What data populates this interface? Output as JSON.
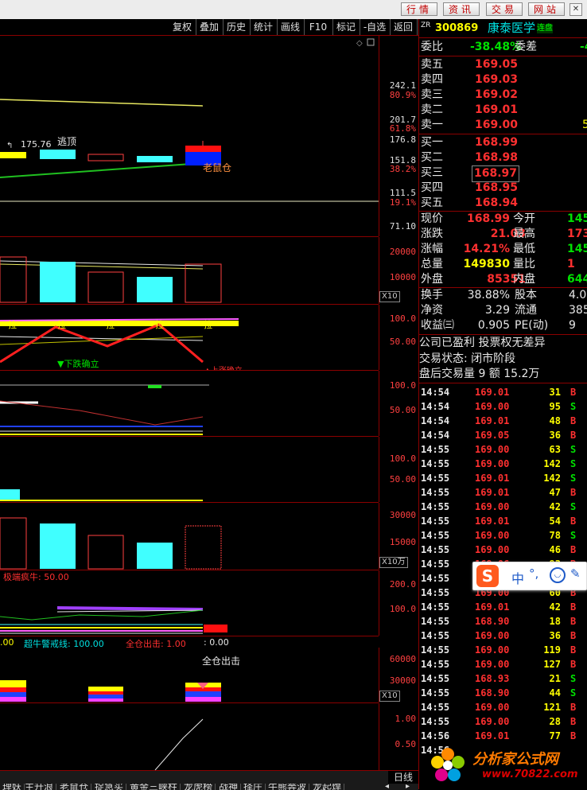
{
  "menubar": {
    "buttons": [
      "行情",
      "资讯",
      "交易",
      "网站"
    ]
  },
  "toolbar": {
    "buttons": [
      "复权",
      "叠加",
      "历史",
      "统计",
      "画线",
      "F10",
      "标记",
      "-自选",
      "返回"
    ]
  },
  "main_pane": {
    "ticks": [
      {
        "v": "242.1",
        "c": "w"
      },
      {
        "v": "80.9%",
        "c": "r"
      },
      {
        "v": "201.7",
        "c": "w"
      },
      {
        "v": "61.8%",
        "c": "r"
      },
      {
        "v": "176.8",
        "c": "w"
      },
      {
        "v": "151.8",
        "c": "w"
      },
      {
        "v": "38.2%",
        "c": "r"
      },
      {
        "v": "111.5",
        "c": "w"
      },
      {
        "v": "19.1%",
        "c": "r"
      },
      {
        "v": "71.10",
        "c": "w"
      }
    ],
    "high_label": "175.76",
    "escape_label": "逃顶",
    "rat_label": "老鼠仓"
  },
  "vol_pane1": {
    "ticks": [
      "20000",
      "10000"
    ],
    "unit": "X10"
  },
  "ind_pane1": {
    "ticks": [
      "100.0",
      "50.00"
    ],
    "down_label": "▼下跌确立",
    "up_label": "▲上涨确立",
    "marks": [
      "拉",
      "拉",
      "拉",
      "拉",
      "拉"
    ]
  },
  "ind_pane2": {
    "ticks": [
      "100.0",
      "50.00"
    ]
  },
  "ind_pane3": {
    "ticks": [
      "100.0",
      "50.00"
    ]
  },
  "vol_pane2": {
    "ticks": [
      "30000",
      "15000"
    ],
    "unit": "X10万"
  },
  "ind_pane4": {
    "ticks": [
      "200.0",
      "100.0"
    ],
    "title": "极端疯牛: 50.00",
    "footer_a": ".00",
    "footer_b": "超牛警戒线: 100.00",
    "footer_c": "全仓出击: 1.00",
    "footer_d": ": 0.00"
  },
  "vol_pane3": {
    "ticks": [
      "60000",
      "30000"
    ],
    "unit": "X10",
    "label": "全仓出击"
  },
  "ind_pane5": {
    "ticks": [
      "1.00",
      "0.50"
    ]
  },
  "tabs": [
    "理妖",
    "主升浪",
    "老鼠仓",
    "捉急买",
    "黄金三峡柱",
    "龙虎榜",
    "战神",
    "择庄",
    "牛熊奔波",
    "龙起焊"
  ],
  "tabs_right": "日线",
  "quote": {
    "code_prefix": "ZR",
    "code": "300869",
    "name": "康泰医学",
    "badge": "连盘",
    "weibi_label": "委比",
    "weibi_value": "-38.48%",
    "weicha_label": "委差",
    "weicha_value": "-4",
    "asks": [
      {
        "label": "卖五",
        "price": "169.05",
        "vol": ""
      },
      {
        "label": "卖四",
        "price": "169.03",
        "vol": ""
      },
      {
        "label": "卖三",
        "price": "169.02",
        "vol": ""
      },
      {
        "label": "卖二",
        "price": "169.01",
        "vol": ""
      },
      {
        "label": "卖一",
        "price": "169.00",
        "vol": "5"
      }
    ],
    "bids": [
      {
        "label": "买一",
        "price": "168.99",
        "vol": ""
      },
      {
        "label": "买二",
        "price": "168.98",
        "vol": ""
      },
      {
        "label": "买三",
        "price": "168.97",
        "vol": ""
      },
      {
        "label": "买四",
        "price": "168.95",
        "vol": ""
      },
      {
        "label": "买五",
        "price": "168.94",
        "vol": ""
      }
    ],
    "stats": [
      {
        "l1": "现价",
        "v1": "168.99",
        "c1": "red",
        "l2": "今开",
        "v2": "145",
        "c2": "green"
      },
      {
        "l1": "涨跌",
        "v1": "21.03",
        "c1": "red",
        "l2": "最高",
        "v2": "173",
        "c2": "red"
      },
      {
        "l1": "涨幅",
        "v1": "14.21%",
        "c1": "red",
        "l2": "最低",
        "v2": "145",
        "c2": "green"
      },
      {
        "l1": "总量",
        "v1": "149830",
        "c1": "yellow",
        "l2": "量比",
        "v2": "1",
        "c2": "red"
      },
      {
        "l1": "外盘",
        "v1": "85351",
        "c1": "red",
        "l2": "内盘",
        "v2": "644",
        "c2": "green"
      }
    ],
    "stats2": [
      {
        "l1": "换手",
        "v1": "38.88%",
        "c1": "white",
        "l2": "股本",
        "v2": "4.0"
      },
      {
        "l1": "净资",
        "v1": "3.29",
        "c1": "white",
        "l2": "流通",
        "v2": "385"
      },
      {
        "l1": "收益㈢",
        "v1": "0.905",
        "c1": "white",
        "l2": "PE(动)",
        "v2": "9"
      }
    ],
    "info": [
      "公司已盈利 投票权无差异",
      "交易状态: 闭市阶段",
      "盘后交易量 9 额 15.2万"
    ]
  },
  "trades": [
    {
      "t": "14:54",
      "p": "169.01",
      "v": "31",
      "s": "B"
    },
    {
      "t": "14:54",
      "p": "169.00",
      "v": "95",
      "s": "S"
    },
    {
      "t": "14:54",
      "p": "169.01",
      "v": "48",
      "s": "B"
    },
    {
      "t": "14:54",
      "p": "169.05",
      "v": "36",
      "s": "B"
    },
    {
      "t": "14:55",
      "p": "169.00",
      "v": "63",
      "s": "S"
    },
    {
      "t": "14:55",
      "p": "169.00",
      "v": "142",
      "s": "S"
    },
    {
      "t": "14:55",
      "p": "169.01",
      "v": "142",
      "s": "S"
    },
    {
      "t": "14:55",
      "p": "169.01",
      "v": "47",
      "s": "B"
    },
    {
      "t": "14:55",
      "p": "169.00",
      "v": "42",
      "s": "S"
    },
    {
      "t": "14:55",
      "p": "169.01",
      "v": "54",
      "s": "B"
    },
    {
      "t": "14:55",
      "p": "169.00",
      "v": "78",
      "s": "S"
    },
    {
      "t": "14:55",
      "p": "169.00",
      "v": "46",
      "s": "B"
    },
    {
      "t": "14:55",
      "p": "169.06",
      "v": "93",
      "s": "B"
    },
    {
      "t": "14:55",
      "p": "169.00",
      "v": "",
      "s": ""
    },
    {
      "t": "14:55",
      "p": "169.00",
      "v": "60",
      "s": "B"
    },
    {
      "t": "14:55",
      "p": "169.01",
      "v": "42",
      "s": "B"
    },
    {
      "t": "14:55",
      "p": "168.90",
      "v": "18",
      "s": "B"
    },
    {
      "t": "14:55",
      "p": "169.00",
      "v": "36",
      "s": "B"
    },
    {
      "t": "14:55",
      "p": "169.00",
      "v": "119",
      "s": "B"
    },
    {
      "t": "14:55",
      "p": "169.00",
      "v": "127",
      "s": "B"
    },
    {
      "t": "14:55",
      "p": "168.93",
      "v": "21",
      "s": "S"
    },
    {
      "t": "14:55",
      "p": "168.90",
      "v": "44",
      "s": "S"
    },
    {
      "t": "14:55",
      "p": "169.00",
      "v": "121",
      "s": "B"
    },
    {
      "t": "14:55",
      "p": "169.00",
      "v": "28",
      "s": "B"
    },
    {
      "t": "14:56",
      "p": "169.01",
      "v": "77",
      "s": "B"
    },
    {
      "t": "14:56",
      "p": "",
      "v": "",
      "s": ""
    }
  ],
  "ime_bar": {
    "letter": "S",
    "lang": "中",
    "punct": "°,"
  },
  "watermark": {
    "brand": "分析家公式网",
    "url": "www.70822.com"
  }
}
